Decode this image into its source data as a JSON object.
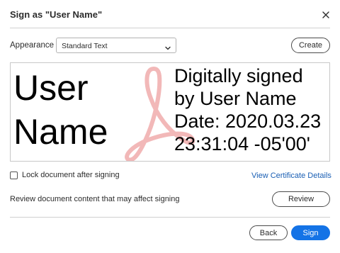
{
  "dialog": {
    "title": "Sign as \"User Name\"",
    "close_icon": "close-icon"
  },
  "appearance": {
    "label": "Appearance",
    "selected": "Standard Text",
    "create_label": "Create"
  },
  "preview": {
    "name_line1": "User",
    "name_line2": "Name",
    "detail_lines": [
      "Digitally signed",
      "by User Name",
      "Date: 2020.03.23",
      "23:31:04 -05'00'"
    ],
    "logo_icon": "acrobat-logo-icon",
    "logo_color": "#f2b8b8"
  },
  "options": {
    "lock_label": "Lock document after signing",
    "lock_checked": false,
    "certificate_link": "View Certificate Details",
    "review_text": "Review document content that may affect signing",
    "review_label": "Review"
  },
  "footer": {
    "back_label": "Back",
    "sign_label": "Sign"
  },
  "colors": {
    "accent": "#1473e6",
    "link": "#1a5fb4"
  }
}
